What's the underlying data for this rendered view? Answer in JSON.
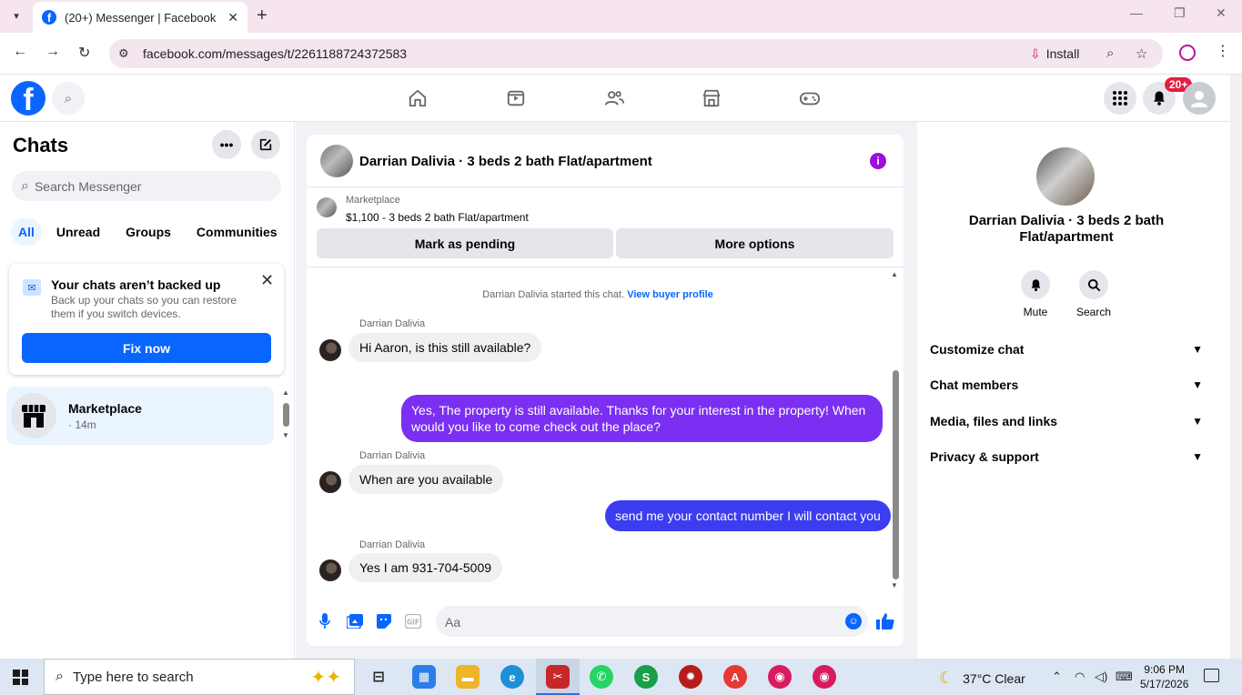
{
  "browser": {
    "tab_title": "(20+) Messenger | Facebook",
    "url": "facebook.com/messages/t/2261188724372583",
    "install_label": "Install",
    "icons": [
      "tab-list-icon",
      "close-icon",
      "plus-icon",
      "back-icon",
      "forward-icon",
      "reload-icon",
      "site-info-icon",
      "install-icon",
      "zoom-icon",
      "star-icon",
      "profile-icon",
      "menu-icon"
    ]
  },
  "fb": {
    "logo": "f",
    "notif_badge": "20+",
    "nav_icons": [
      "home-icon",
      "video-icon",
      "friends-icon",
      "marketplace-icon",
      "gaming-icon"
    ],
    "accent": "#0866ff"
  },
  "sidebar": {
    "title": "Chats",
    "search_placeholder": "Search Messenger",
    "filters": [
      "All",
      "Unread",
      "Groups",
      "Communities"
    ],
    "active_filter": "All",
    "backup": {
      "title": "Your chats aren’t backed up",
      "text": "Back up your chats so you can restore them if you switch devices.",
      "button": "Fix now"
    },
    "conversations": [
      {
        "name": "Marketplace",
        "time": "· 14m"
      }
    ]
  },
  "chat": {
    "title": "Darrian Dalivia · 3 beds 2 bath Flat/apartment",
    "marketplace_label": "Marketplace",
    "listing": "$1,100 - 3 beds 2 bath Flat/apartment",
    "btn_pending": "Mark as pending",
    "btn_more": "More options",
    "system_text": "Darrian Dalivia started this chat.",
    "system_link": "View buyer profile",
    "messages": [
      {
        "sender": "Darrian Dalivia",
        "text": "Hi Aaron, is this still available?"
      },
      {
        "text": "Yes, The property is still available. Thanks for your interest in the property! When would you like to come check out the place?"
      },
      {
        "sender": "Darrian Dalivia",
        "text": "When are you available"
      },
      {
        "text": "send me your contact number I will contact you"
      },
      {
        "sender": "Darrian Dalivia",
        "text": "Yes I am 931-704-5009"
      }
    ],
    "composer_placeholder": "Aa",
    "colors": {
      "outgoing_purple": "#7b2ff2",
      "outgoing_blue": "#3c3cf0",
      "incoming": "#f0f0f0"
    }
  },
  "info": {
    "name": "Darrian Dalivia · 3 beds 2 bath Flat/apartment",
    "actions": [
      "Mute",
      "Search"
    ],
    "sections": [
      "Customize chat",
      "Chat members",
      "Media, files and links",
      "Privacy & support"
    ]
  },
  "taskbar": {
    "search_placeholder": "Type here to search",
    "weather": "37°C  Clear",
    "time": "9:06 PM",
    "date": "5/17/2026"
  }
}
